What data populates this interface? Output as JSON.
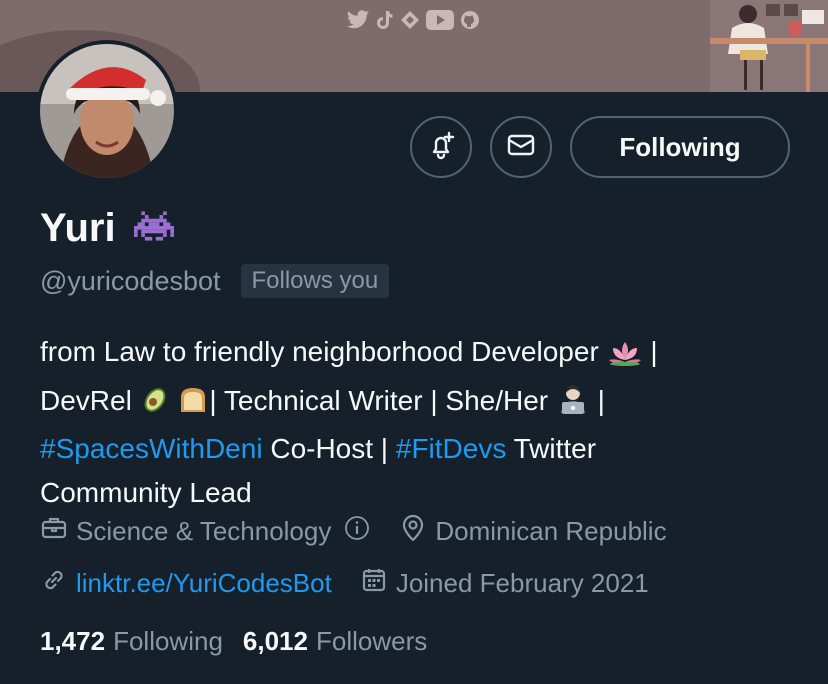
{
  "profile": {
    "display_name": "Yuri",
    "handle": "@yuricodesbot",
    "follows_you": "Follows you",
    "follow_state": "Following",
    "bio": {
      "line1_text": "from Law to friendly neighborhood Developer",
      "line1_sep": " |",
      "line2_a": "DevRel",
      "line2_b": "| Technical Writer | She/Her",
      "line2_sep": " |",
      "hashtag1": "#SpacesWithDeni",
      "line3_mid": " Co-Host | ",
      "hashtag2": "#FitDevs",
      "line3_end": " Twitter",
      "line4": "Community Lead"
    },
    "category": "Science & Technology",
    "location": "Dominican Republic",
    "website": "linktr.ee/YuriCodesBot",
    "joined": "Joined February 2021",
    "following_count": "1,472",
    "following_label": "Following",
    "followers_count": "6,012",
    "followers_label": "Followers"
  },
  "icons": {
    "notify": "bell-plus-icon",
    "message": "envelope-icon",
    "category": "briefcase-icon",
    "info": "info-icon",
    "location": "location-pin-icon",
    "link": "link-icon",
    "calendar": "calendar-icon",
    "name_emoji": "alien-monster-icon"
  },
  "colors": {
    "background": "#15202b",
    "accent": "#1d9bf0",
    "muted": "#8b98a5",
    "banner": "#7e6b6c"
  }
}
